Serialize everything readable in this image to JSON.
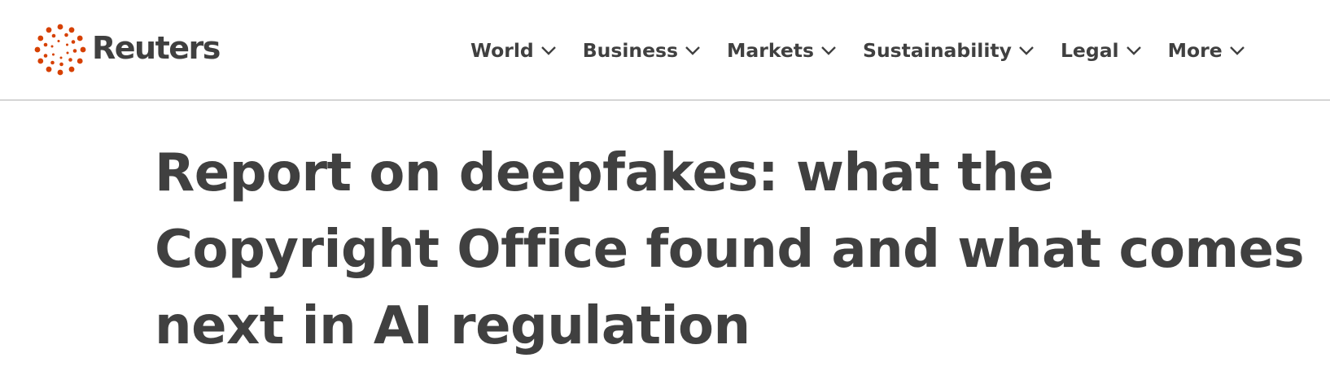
{
  "brand": {
    "name": "Reuters",
    "logo_color": "#d64000"
  },
  "nav": {
    "items": [
      {
        "label": "World",
        "icon": "chevron-down-icon"
      },
      {
        "label": "Business",
        "icon": "chevron-down-icon"
      },
      {
        "label": "Markets",
        "icon": "chevron-down-icon"
      },
      {
        "label": "Sustainability",
        "icon": "chevron-down-icon"
      },
      {
        "label": "Legal",
        "icon": "chevron-down-icon"
      },
      {
        "label": "More",
        "icon": "chevron-down-icon"
      }
    ]
  },
  "article": {
    "headline": "Report on deepfakes: what the Copyright Office found and what comes next in AI regulation"
  },
  "colors": {
    "text": "#404040",
    "divider": "#d5d5d5",
    "background": "#ffffff"
  }
}
